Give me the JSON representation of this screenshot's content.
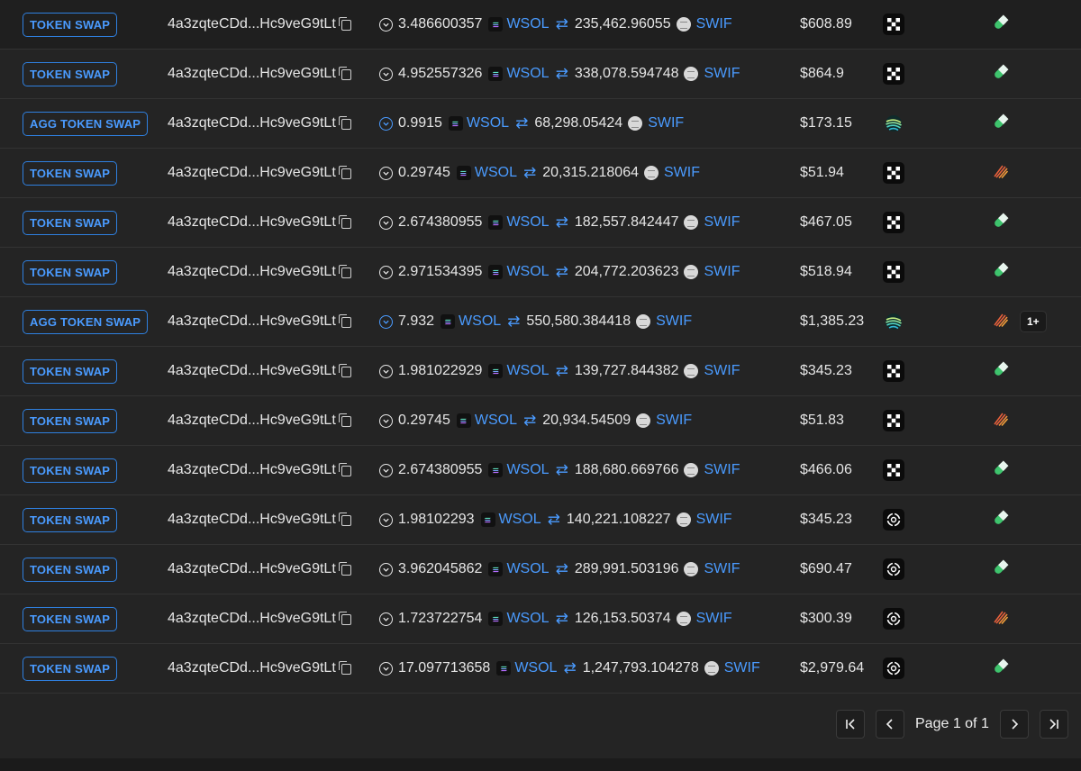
{
  "rows": [
    {
      "type": "TOKEN SWAP",
      "signature": "4a3zqteCDd...Hc9veG9tLt",
      "amount_in": "3.486600357",
      "token_in": "WSOL",
      "amount_out": "235,462.96055",
      "token_out": "SWIF",
      "value": "$608.89",
      "platform": "okx",
      "source": "pill",
      "extra": ""
    },
    {
      "type": "TOKEN SWAP",
      "signature": "4a3zqteCDd...Hc9veG9tLt",
      "amount_in": "4.952557326",
      "token_in": "WSOL",
      "amount_out": "338,078.594748",
      "token_out": "SWIF",
      "value": "$864.9",
      "platform": "okx",
      "source": "pill",
      "extra": ""
    },
    {
      "type": "AGG TOKEN SWAP",
      "signature": "4a3zqteCDd...Hc9veG9tLt",
      "amount_in": "0.9915",
      "token_in": "WSOL",
      "amount_out": "68,298.05424",
      "token_out": "SWIF",
      "value": "$173.15",
      "platform": "jupiter",
      "source": "pill",
      "extra": ""
    },
    {
      "type": "TOKEN SWAP",
      "signature": "4a3zqteCDd...Hc9veG9tLt",
      "amount_in": "0.29745",
      "token_in": "WSOL",
      "amount_out": "20,315.218064",
      "token_out": "SWIF",
      "value": "$51.94",
      "platform": "okx",
      "source": "meteora",
      "extra": ""
    },
    {
      "type": "TOKEN SWAP",
      "signature": "4a3zqteCDd...Hc9veG9tLt",
      "amount_in": "2.674380955",
      "token_in": "WSOL",
      "amount_out": "182,557.842447",
      "token_out": "SWIF",
      "value": "$467.05",
      "platform": "okx",
      "source": "pill",
      "extra": ""
    },
    {
      "type": "TOKEN SWAP",
      "signature": "4a3zqteCDd...Hc9veG9tLt",
      "amount_in": "2.971534395",
      "token_in": "WSOL",
      "amount_out": "204,772.203623",
      "token_out": "SWIF",
      "value": "$518.94",
      "platform": "okx",
      "source": "pill",
      "extra": ""
    },
    {
      "type": "AGG TOKEN SWAP",
      "signature": "4a3zqteCDd...Hc9veG9tLt",
      "amount_in": "7.932",
      "token_in": "WSOL",
      "amount_out": "550,580.384418",
      "token_out": "SWIF",
      "value": "$1,385.23",
      "platform": "jupiter",
      "source": "meteora",
      "extra": "1+"
    },
    {
      "type": "TOKEN SWAP",
      "signature": "4a3zqteCDd...Hc9veG9tLt",
      "amount_in": "1.981022929",
      "token_in": "WSOL",
      "amount_out": "139,727.844382",
      "token_out": "SWIF",
      "value": "$345.23",
      "platform": "okx",
      "source": "pill",
      "extra": ""
    },
    {
      "type": "TOKEN SWAP",
      "signature": "4a3zqteCDd...Hc9veG9tLt",
      "amount_in": "0.29745",
      "token_in": "WSOL",
      "amount_out": "20,934.54509",
      "token_out": "SWIF",
      "value": "$51.83",
      "platform": "okx",
      "source": "meteora",
      "extra": ""
    },
    {
      "type": "TOKEN SWAP",
      "signature": "4a3zqteCDd...Hc9veG9tLt",
      "amount_in": "2.674380955",
      "token_in": "WSOL",
      "amount_out": "188,680.669766",
      "token_out": "SWIF",
      "value": "$466.06",
      "platform": "okx",
      "source": "pill",
      "extra": ""
    },
    {
      "type": "TOKEN SWAP",
      "signature": "4a3zqteCDd...Hc9veG9tLt",
      "amount_in": "1.98102293",
      "token_in": "WSOL",
      "amount_out": "140,221.108227",
      "token_out": "SWIF",
      "value": "$345.23",
      "platform": "target",
      "source": "pill",
      "extra": ""
    },
    {
      "type": "TOKEN SWAP",
      "signature": "4a3zqteCDd...Hc9veG9tLt",
      "amount_in": "3.962045862",
      "token_in": "WSOL",
      "amount_out": "289,991.503196",
      "token_out": "SWIF",
      "value": "$690.47",
      "platform": "target",
      "source": "pill",
      "extra": ""
    },
    {
      "type": "TOKEN SWAP",
      "signature": "4a3zqteCDd...Hc9veG9tLt",
      "amount_in": "1.723722754",
      "token_in": "WSOL",
      "amount_out": "126,153.50374",
      "token_out": "SWIF",
      "value": "$300.39",
      "platform": "target",
      "source": "meteora",
      "extra": ""
    },
    {
      "type": "TOKEN SWAP",
      "signature": "4a3zqteCDd...Hc9veG9tLt",
      "amount_in": "17.097713658",
      "token_in": "WSOL",
      "amount_out": "1,247,793.104278",
      "token_out": "SWIF",
      "value": "$2,979.64",
      "platform": "target",
      "source": "pill",
      "extra": ""
    }
  ],
  "pagination": {
    "label": "Page 1 of 1"
  },
  "colors": {
    "accent": "#4a9bff",
    "background": "#242424",
    "pill_green": "#3ec46d",
    "meteora_orange": "#e8613c"
  }
}
